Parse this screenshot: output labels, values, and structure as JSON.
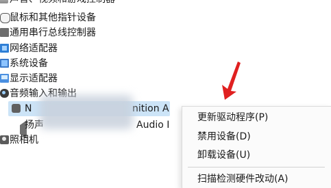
{
  "device_tree": {
    "items": [
      {
        "label": "声音、视频和游戏控制器",
        "icon": "sound-icon"
      },
      {
        "label": "鼠标和其他指针设备",
        "icon": "mouse-icon"
      },
      {
        "label": "通用串行总线控制器",
        "icon": "usb-icon"
      },
      {
        "label": "网络适配器",
        "icon": "network-adapter-icon"
      },
      {
        "label": "系统设备",
        "icon": "system-device-icon"
      },
      {
        "label": "显示适配器",
        "icon": "display-adapter-icon"
      },
      {
        "label": "音频输入和输出",
        "icon": "audio-io-icon"
      },
      {
        "label": "照相机",
        "icon": "camera-icon"
      }
    ],
    "children": [
      {
        "label_visible": "N",
        "label_suffix": "nition A",
        "icon": "microphone-icon"
      },
      {
        "label_visible": "扬声",
        "label_suffix": "Audio I",
        "icon": "speaker-icon"
      }
    ],
    "selection_color": "#cce4f7"
  },
  "context_menu": {
    "items": [
      {
        "label": "更新驱动程序(P)"
      },
      {
        "label": "禁用设备(D)"
      },
      {
        "label": "卸载设备(U)"
      },
      {
        "label": "扫描检测硬件改动(A)"
      }
    ]
  },
  "annotation": {
    "arrow_color": "#e02020"
  }
}
